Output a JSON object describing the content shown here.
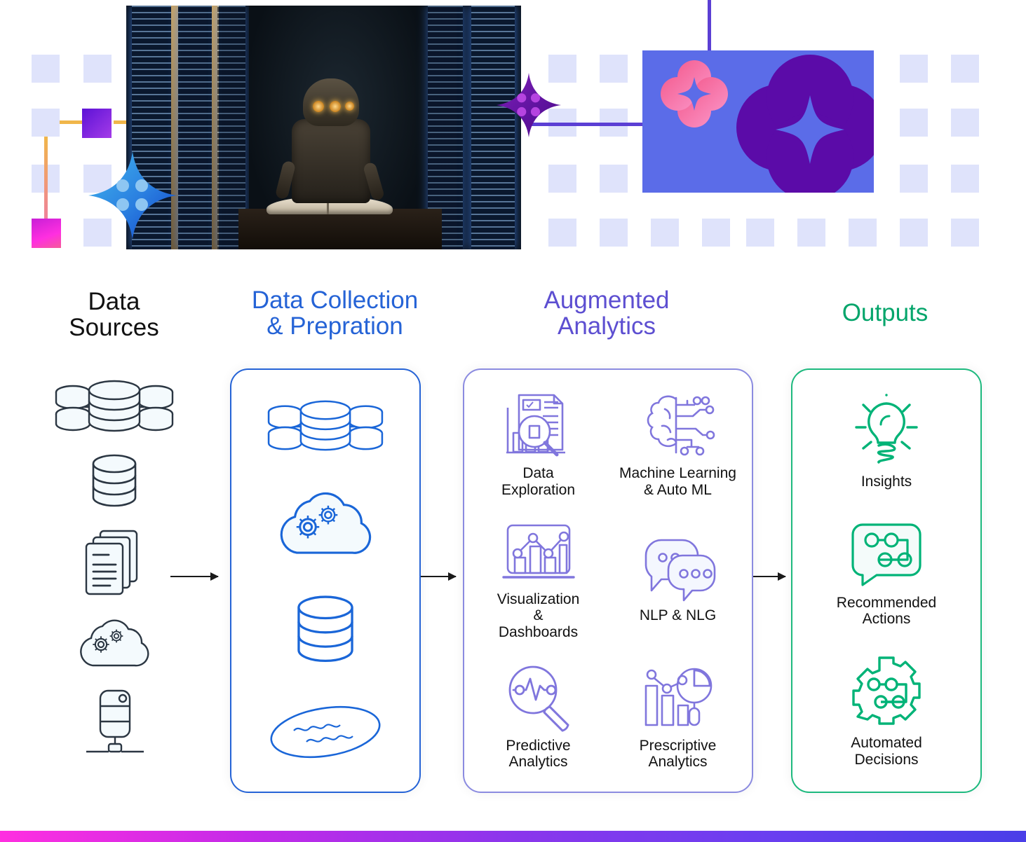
{
  "hero": {
    "photo_alt": "robot-reading-book-in-data-center",
    "graphic_alt": "ai-cloud-sparkle-graphic",
    "colors": {
      "grid_square": "#dfe3fb",
      "accent_purple": "#5c12d6",
      "accent_magenta": "#ff2fe0",
      "connector_orange": "#f0b64a",
      "connector_purple": "#5b3fd4",
      "panel_blue": "#5b6ce8",
      "cloud_purple": "#5b0ba8",
      "flower_pink": "#f2689c"
    }
  },
  "columns": {
    "sources": {
      "title": "Data\nSources",
      "color": "#111111",
      "items": [
        {
          "icon": "distributed-database-icon",
          "label": ""
        },
        {
          "icon": "database-cylinder-icon",
          "label": ""
        },
        {
          "icon": "documents-stack-icon",
          "label": ""
        },
        {
          "icon": "cloud-gears-icon",
          "label": ""
        },
        {
          "icon": "server-device-icon",
          "label": ""
        }
      ]
    },
    "collection": {
      "title": "Data Collection\n& Prepration",
      "color": "#2563d6",
      "items": [
        {
          "icon": "distributed-database-icon"
        },
        {
          "icon": "cloud-gears-icon"
        },
        {
          "icon": "database-cylinder-icon"
        },
        {
          "icon": "data-lake-icon"
        }
      ]
    },
    "augmented": {
      "title": "Augmented\nAnalytics",
      "color": "#5d4fd1",
      "items": [
        {
          "icon": "report-magnifier-icon",
          "label": "Data\nExploration"
        },
        {
          "icon": "brain-circuit-icon",
          "label": "Machine Learning\n& Auto ML"
        },
        {
          "icon": "chart-dashboard-icon",
          "label": "Visualization\n&\nDashboards"
        },
        {
          "icon": "speech-bubbles-icon",
          "label": "NLP & NLG"
        },
        {
          "icon": "magnifier-pulse-icon",
          "label": "Predictive\nAnalytics"
        },
        {
          "icon": "bar-pie-chart-icon",
          "label": "Prescriptive\nAnalytics"
        }
      ]
    },
    "outputs": {
      "title": "Outputs",
      "color": "#05a56b",
      "items": [
        {
          "icon": "lightbulb-icon",
          "label": "Insights"
        },
        {
          "icon": "speech-flow-icon",
          "label": "Recommended\nActions"
        },
        {
          "icon": "gear-flow-icon",
          "label": "Automated\nDecisions"
        }
      ]
    }
  },
  "flow": {
    "arrows": [
      "arrow-sources-to-collection",
      "arrow-collection-to-augmented",
      "arrow-augmented-to-outputs"
    ]
  },
  "footer": {
    "bar_gradient_start": "#ff2fe0",
    "bar_gradient_end": "#4a3fe8"
  }
}
